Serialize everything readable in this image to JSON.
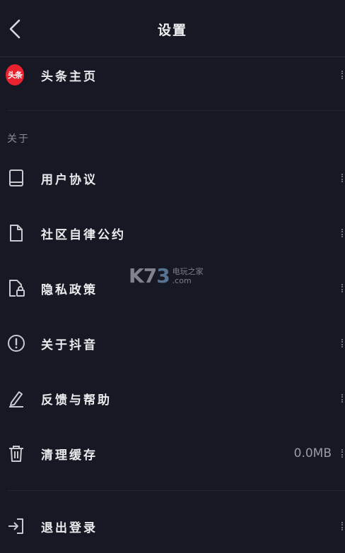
{
  "header": {
    "title": "设置"
  },
  "top_item": {
    "logo_text": "头条",
    "label": "头条主页",
    "logo_color": "#e8232f"
  },
  "section": {
    "title": "关于"
  },
  "items": [
    {
      "label": "用户协议",
      "icon": "book-icon"
    },
    {
      "label": "社区自律公约",
      "icon": "document-icon"
    },
    {
      "label": "隐私政策",
      "icon": "privacy-lock-icon"
    },
    {
      "label": "关于抖音",
      "icon": "info-circle-icon"
    },
    {
      "label": "反馈与帮助",
      "icon": "pencil-icon"
    },
    {
      "label": "清理缓存",
      "icon": "trash-icon",
      "value": "0.0MB"
    }
  ],
  "logout": {
    "label": "退出登录",
    "icon": "logout-icon"
  },
  "watermark": {
    "brand_a": "K7",
    "brand_b": "3",
    "line1": "电玩之家",
    "line2": ".com"
  },
  "colors": {
    "background": "#161823",
    "text": "#ececef",
    "muted": "#8a8b94"
  }
}
